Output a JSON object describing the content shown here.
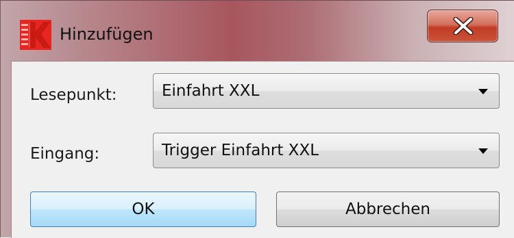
{
  "window": {
    "title": "Hinzufügen",
    "app_icon": "red-k-logo-icon",
    "close_icon": "close-x-icon"
  },
  "form": {
    "lesepunkt_label": "Lesepunkt:",
    "lesepunkt_value": "Einfahrt XXL",
    "eingang_label": "Eingang:",
    "eingang_value": "Trigger Einfahrt XXL",
    "dropdown_icon": "chevron-down-icon"
  },
  "buttons": {
    "ok_label": "OK",
    "cancel_label": "Abbrechen"
  },
  "colors": {
    "logo_red": "#e8261f",
    "close_button_red": "#c23c25",
    "ok_button_blue": "#a7d9f5"
  }
}
